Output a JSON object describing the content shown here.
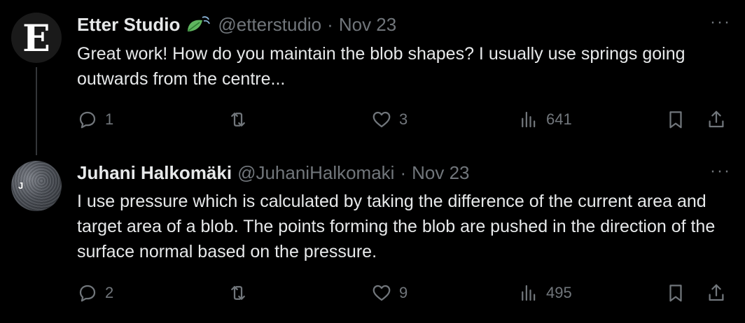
{
  "tweets": [
    {
      "avatar_letter": "E",
      "name": "Etter Studio",
      "badge_icon": "leaf-wind-icon",
      "handle": "@etterstudio",
      "separator": "·",
      "date": "Nov 23",
      "more": "···",
      "text": "Great work! How do you maintain the blob shapes? I usually use springs going outwards from the centre...",
      "replies": "1",
      "retweets": "",
      "likes": "3",
      "views": "641"
    },
    {
      "avatar_letter": "J",
      "name": "Juhani Halkomäki",
      "handle": "@JuhaniHalkomaki",
      "separator": "·",
      "date": "Nov 23",
      "more": "···",
      "text": "I use pressure which is calculated by taking the difference of the current area and target area of a blob. The points forming the blob are pushed in the direction of the surface normal based on the pressure.",
      "replies": "2",
      "retweets": "",
      "likes": "9",
      "views": "495"
    }
  ]
}
